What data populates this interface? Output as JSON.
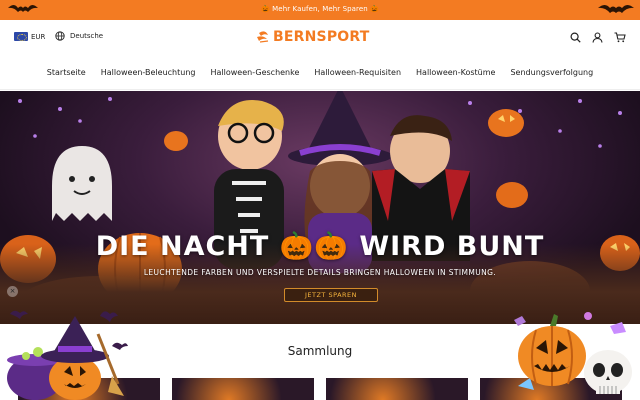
{
  "announcement": {
    "text": "🎃 Mehr Kaufen, Mehr Sparen 🎃"
  },
  "header": {
    "currency": "EUR",
    "language": "Deutsche",
    "logo": "BERNSPORT"
  },
  "nav": {
    "items": [
      {
        "label": "Startseite"
      },
      {
        "label": "Halloween-Beleuchtung"
      },
      {
        "label": "Halloween-Geschenke"
      },
      {
        "label": "Halloween-Requisiten"
      },
      {
        "label": "Halloween-Kostüme"
      },
      {
        "label": "Sendungsverfolgung"
      }
    ]
  },
  "hero": {
    "title": "DIE NACHT 🎃🎃 WIRD BUNT",
    "subtitle": "LEUCHTENDE FARBEN UND VERSPIELTE DETAILS BRINGEN HALLOWEEN IN STIMMUNG.",
    "cta": "JETZT SPAREN"
  },
  "collection": {
    "title": "Sammlung"
  },
  "colors": {
    "accent": "#f37b22",
    "hero_dark": "#2a1828"
  },
  "icons": [
    "eu-flag-icon",
    "globe-icon",
    "logo-mark-icon",
    "search-icon",
    "user-icon",
    "cart-icon",
    "close-icon"
  ]
}
